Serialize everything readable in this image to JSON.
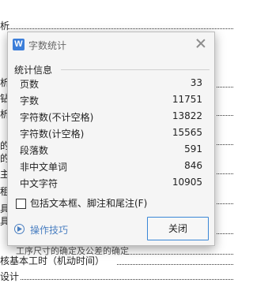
{
  "document": {
    "line_bottom_1": "核基本工时（机动时间）",
    "line_bottom_2": "设计",
    "line_bottom_frag": "工序尺寸的确定及公差的确定",
    "left_fragments": [
      "析",
      "析",
      "钻",
      "析",
      "的",
      "的",
      "主",
      "租",
      "具",
      "具"
    ]
  },
  "dialog": {
    "title": "字数统计",
    "app_icon_letter": "W",
    "close_icon": "close-icon",
    "section_title": "统计信息",
    "stats": [
      {
        "label": "页数",
        "value": "33"
      },
      {
        "label": "字数",
        "value": "11751"
      },
      {
        "label": "字符数(不计空格)",
        "value": "13822"
      },
      {
        "label": "字符数(计空格)",
        "value": "15565"
      },
      {
        "label": "段落数",
        "value": "591"
      },
      {
        "label": "非中文单词",
        "value": "846"
      },
      {
        "label": "中文字符",
        "value": "10905"
      }
    ],
    "checkbox_label": "包括文本框、脚注和尾注(F)",
    "checkbox_checked": false,
    "tips_label": "操作技巧",
    "close_button_label": "关闭",
    "accent_color": "#3a87d6"
  }
}
